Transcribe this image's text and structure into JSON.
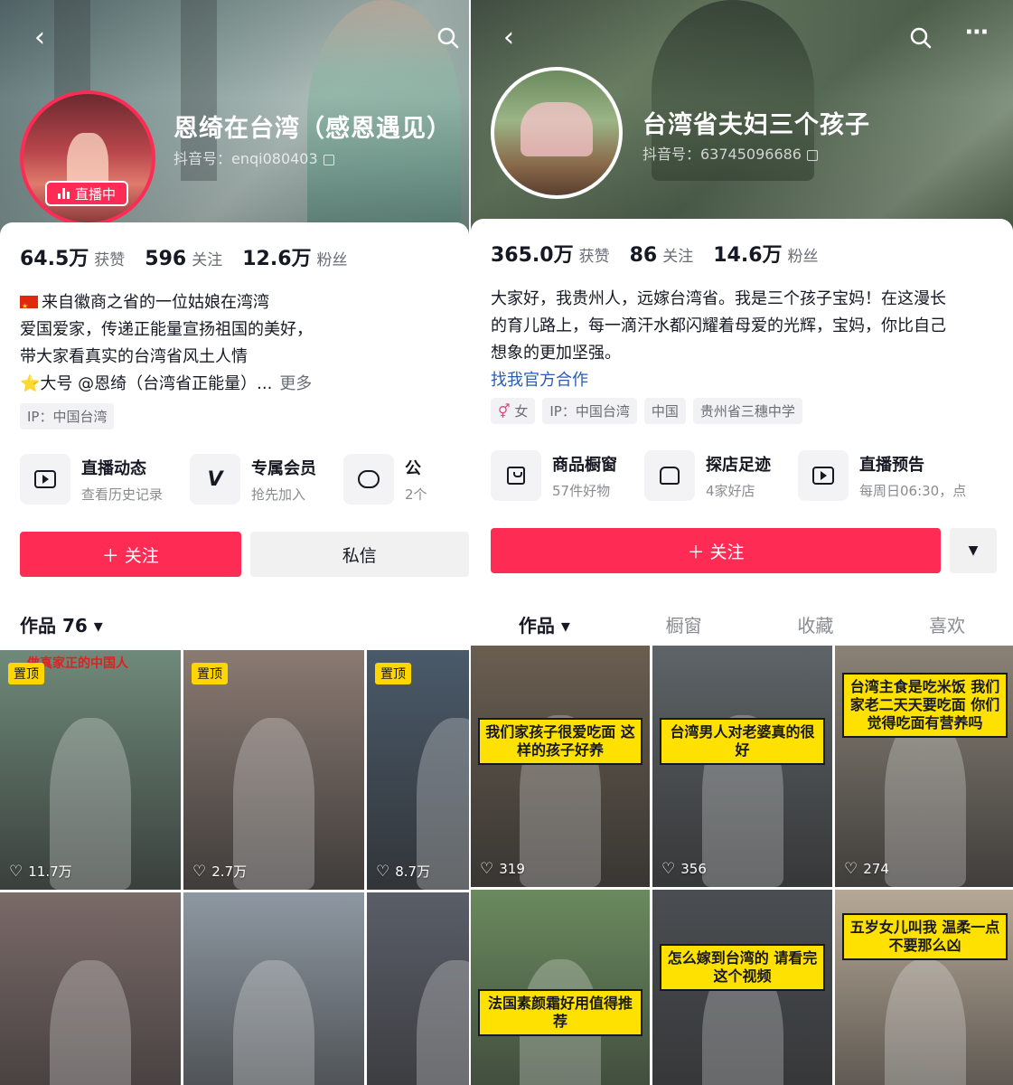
{
  "left_profile": {
    "name": "恩绮在台湾（感恩遇见）",
    "douyin_id": "抖音号：enqi080403",
    "live_badge": "直播中",
    "stats": [
      {
        "value": "64.5万",
        "label": "获赞"
      },
      {
        "value": "596",
        "label": "关注"
      },
      {
        "value": "12.6万",
        "label": "粉丝"
      }
    ],
    "bio_lines": [
      "来自徽商之省的一位姑娘在湾湾",
      "爱国爱家，传递正能量宣扬祖国的美好，",
      "带大家看真实的台湾省风土人情",
      "⭐大号 @恩绮（台湾省正能量）..."
    ],
    "bio_more": "更多",
    "tags": [
      "IP：中国台湾"
    ],
    "features": [
      {
        "title": "直播动态",
        "sub": "查看历史记录",
        "icon": "tv-icon"
      },
      {
        "title": "专属会员",
        "sub": "抢先加入",
        "icon": "v-icon"
      },
      {
        "title": "公",
        "sub": "2个",
        "icon": "chat-icon"
      }
    ],
    "follow_label": "＋ 关注",
    "message_label": "私信",
    "works_label": "作品 76 ▾",
    "videos": [
      {
        "pinned": "置顶",
        "likes": "11.7万",
        "overlay": "做真家正的中国人",
        "color": "#6f8a7a"
      },
      {
        "pinned": "置顶",
        "likes": "2.7万",
        "overlay": "",
        "color": "#8a7a72"
      },
      {
        "pinned": "置顶",
        "likes": "8.7万",
        "overlay": "",
        "color": "#4a5a6a"
      },
      {
        "pinned": "",
        "likes": "",
        "overlay": "",
        "color": "#7a6a68"
      },
      {
        "pinned": "",
        "likes": "",
        "overlay": "",
        "color": "#8e98a2"
      },
      {
        "pinned": "",
        "likes": "",
        "overlay": "",
        "color": "#5a5e68"
      }
    ]
  },
  "right_profile": {
    "name": "台湾省夫妇三个孩子",
    "douyin_id": "抖音号：63745096686",
    "stats": [
      {
        "value": "365.0万",
        "label": "获赞"
      },
      {
        "value": "86",
        "label": "关注"
      },
      {
        "value": "14.6万",
        "label": "粉丝"
      }
    ],
    "bio_lines": [
      "大家好，我贵州人，远嫁台湾省。我是三个孩子宝妈！在这漫长",
      "的育儿路上，每一滴汗水都闪耀着母爱的光辉，宝妈，你比自己",
      "想象的更加坚强。"
    ],
    "coop_link": "找我官方合作",
    "tags": [
      "女",
      "IP：中国台湾",
      "中国",
      "贵州省三穗中学"
    ],
    "features": [
      {
        "title": "商品橱窗",
        "sub": "57件好物",
        "icon": "bag-icon"
      },
      {
        "title": "探店足迹",
        "sub": "4家好店",
        "icon": "store-icon"
      },
      {
        "title": "直播预告",
        "sub": "每周日06:30，点",
        "icon": "tv-icon"
      }
    ],
    "follow_label": "＋ 关注",
    "dropdown_label": "▼",
    "tabs": [
      "作品 ▾",
      "橱窗",
      "收藏",
      "喜欢"
    ],
    "videos": [
      {
        "caption": "我们家孩子很爱吃面 这样的孩子好养",
        "likes": "319",
        "color": "#6a5e50"
      },
      {
        "caption": "台湾男人对老婆真的很好",
        "likes": "356",
        "color": "#5e6468"
      },
      {
        "caption": "台湾主食是吃米饭 我们家老二天天要吃面 你们觉得吃面有营养吗",
        "likes": "274",
        "color": "#8a8276"
      },
      {
        "caption": "法国素颜霜好用值得推荐",
        "likes": "",
        "color": "#6a8a5e"
      },
      {
        "caption": "怎么嫁到台湾的 请看完这个视频",
        "likes": "",
        "color": "#4a4e52"
      },
      {
        "caption": "五岁女儿叫我 温柔一点不要那么凶",
        "likes": "",
        "color": "#b6a896"
      }
    ]
  }
}
